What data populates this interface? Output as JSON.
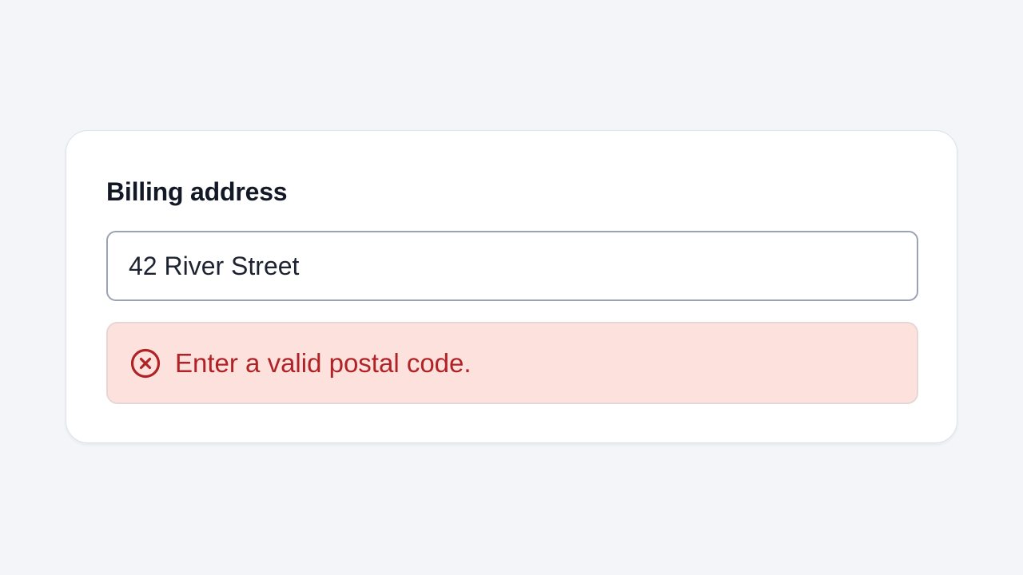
{
  "form": {
    "label": "Billing address",
    "address_value": "42 River Street",
    "error": {
      "icon": "error-circle-x-icon",
      "message": "Enter a valid postal code."
    }
  },
  "colors": {
    "page_background": "#f3f5f9",
    "card_background": "#ffffff",
    "error_background": "#fce1dd",
    "error_text": "#b02226"
  }
}
